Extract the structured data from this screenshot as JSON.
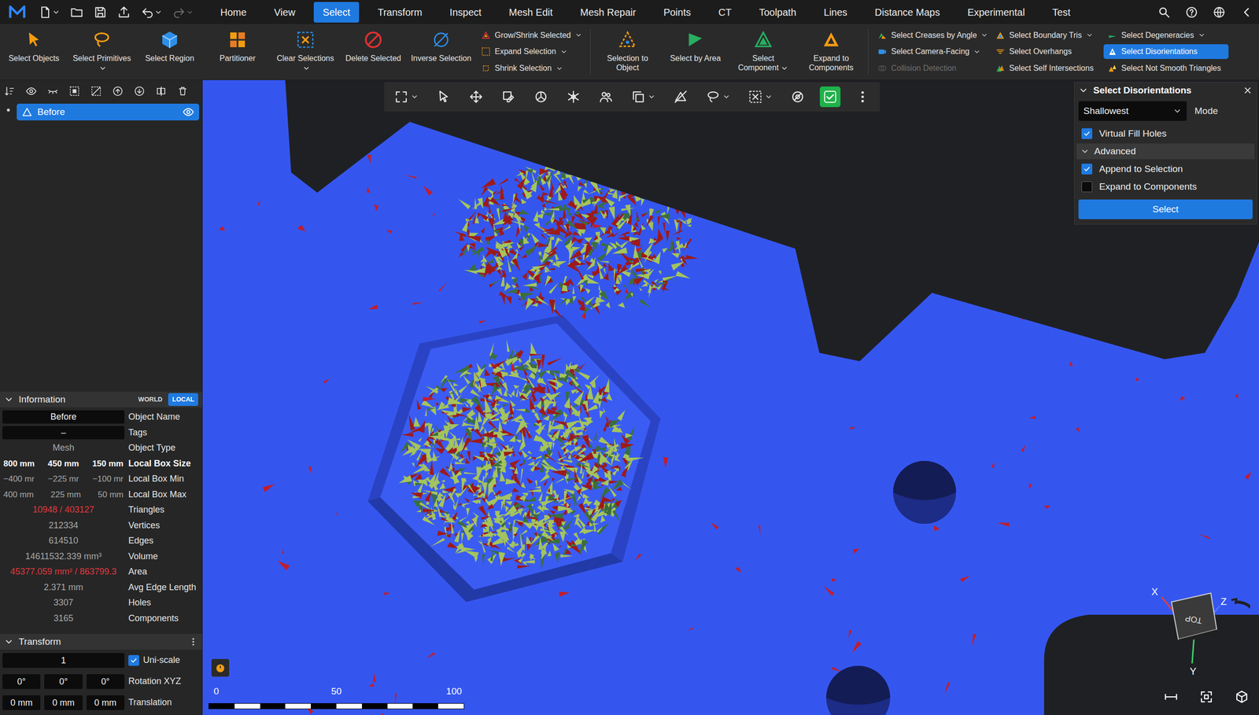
{
  "menubar": {
    "quick_tools": [
      {
        "dropdown": true,
        "disabled": false
      },
      {
        "dropdown": false,
        "disabled": false
      },
      {
        "dropdown": false,
        "disabled": false
      },
      {
        "dropdown": false,
        "disabled": false
      },
      {
        "dropdown": true,
        "disabled": false
      },
      {
        "dropdown": true,
        "disabled": true
      }
    ],
    "tabs": [
      {
        "label": "Home",
        "selected": false
      },
      {
        "label": "View",
        "selected": false
      },
      {
        "label": "Select",
        "selected": true
      },
      {
        "label": "Transform",
        "selected": false
      },
      {
        "label": "Inspect",
        "selected": false
      },
      {
        "label": "Mesh Edit",
        "selected": false
      },
      {
        "label": "Mesh Repair",
        "selected": false
      },
      {
        "label": "Points",
        "selected": false
      },
      {
        "label": "CT",
        "selected": false
      },
      {
        "label": "Toolpath",
        "selected": false
      },
      {
        "label": "Lines",
        "selected": false
      },
      {
        "label": "Distance Maps",
        "selected": false
      },
      {
        "label": "Experimental",
        "selected": false
      },
      {
        "label": "Test",
        "selected": false
      }
    ]
  },
  "ribbon": {
    "groups": [
      {
        "kind": "large",
        "items": [
          {
            "label": "Select Objects",
            "dropdown": false,
            "selected": false,
            "disabled": false
          },
          {
            "label": "Select Primitives",
            "dropdown": true,
            "selected": false,
            "disabled": false
          },
          {
            "label": "Select Region",
            "dropdown": false,
            "selected": false,
            "disabled": false
          },
          {
            "label": "Partitioner",
            "dropdown": false,
            "selected": false,
            "disabled": false
          },
          {
            "label": "Clear Selections",
            "dropdown": true,
            "selected": false,
            "disabled": false
          },
          {
            "label": "Delete Selected",
            "dropdown": false,
            "selected": false,
            "disabled": false
          },
          {
            "label": "Inverse Selection",
            "dropdown": false,
            "selected": false,
            "disabled": false
          }
        ]
      },
      {
        "kind": "small",
        "items": [
          {
            "label": "Grow/Shrink Selected",
            "dropdown": true,
            "selected": false,
            "disabled": false
          },
          {
            "label": "Expand Selection",
            "dropdown": true,
            "selected": false,
            "disabled": false
          },
          {
            "label": "Shrink Selection",
            "dropdown": true,
            "selected": false,
            "disabled": false
          }
        ]
      },
      {
        "kind": "large",
        "items": [
          {
            "label": "Selection to Object",
            "dropdown": false,
            "selected": false,
            "disabled": false
          },
          {
            "label": "Select by Area",
            "dropdown": false,
            "selected": false,
            "disabled": false
          },
          {
            "label": "Select Component",
            "dropdown": true,
            "selected": false,
            "disabled": false
          },
          {
            "label": "Expand to Components",
            "dropdown": false,
            "selected": false,
            "disabled": false
          }
        ]
      },
      {
        "kind": "small",
        "items": [
          {
            "label": "Select Creases by Angle",
            "dropdown": true,
            "selected": false,
            "disabled": false
          },
          {
            "label": "Select Camera-Facing",
            "dropdown": true,
            "selected": false,
            "disabled": false
          },
          {
            "label": "Collision Detection",
            "dropdown": false,
            "selected": false,
            "disabled": true
          }
        ]
      },
      {
        "kind": "small",
        "items": [
          {
            "label": "Select Boundary Tris",
            "dropdown": true,
            "selected": false,
            "disabled": false
          },
          {
            "label": "Select Overhangs",
            "dropdown": false,
            "selected": false,
            "disabled": false
          },
          {
            "label": "Select Self Intersections",
            "dropdown": false,
            "selected": false,
            "disabled": false
          }
        ]
      },
      {
        "kind": "small",
        "items": [
          {
            "label": "Select Degeneracies",
            "dropdown": true,
            "selected": false,
            "disabled": false
          },
          {
            "label": "Select Disorientations",
            "dropdown": false,
            "selected": true,
            "disabled": false
          },
          {
            "label": "Select Not Smooth Triangles",
            "dropdown": false,
            "selected": false,
            "disabled": false
          }
        ]
      }
    ]
  },
  "left_panel": {
    "tree": [
      {
        "label": "Before",
        "selected": true,
        "visible": true
      }
    ],
    "information": {
      "title": "Information",
      "expanded": true,
      "frames": [
        {
          "label": "WORLD",
          "selected": false
        },
        {
          "label": "LOCAL",
          "selected": true
        }
      ],
      "rows": [
        {
          "label": "Object Name",
          "kind": "field",
          "values": [
            "Before"
          ],
          "alert": false,
          "emphasis": false
        },
        {
          "label": "Tags",
          "kind": "field",
          "values": [
            "–"
          ],
          "alert": false,
          "emphasis": false
        },
        {
          "label": "Object Type",
          "kind": "text",
          "values": [
            "Mesh"
          ],
          "alert": false,
          "emphasis": false
        },
        {
          "label": "Local Box Size",
          "kind": "triple",
          "values": [
            "800 mm",
            "450 mm",
            "150 mm"
          ],
          "alert": false,
          "emphasis": true
        },
        {
          "label": "Local Box Min",
          "kind": "triple",
          "values": [
            "−400 mr",
            "−225 mr",
            "−100 mr"
          ],
          "alert": false,
          "emphasis": false
        },
        {
          "label": "Local Box Max",
          "kind": "triple",
          "values": [
            "400 mm",
            "225 mm",
            "50 mm"
          ],
          "alert": false,
          "emphasis": false
        },
        {
          "label": "Triangles",
          "kind": "text",
          "values": [
            "10948 / 403127"
          ],
          "alert": true,
          "emphasis": false
        },
        {
          "label": "Vertices",
          "kind": "text",
          "values": [
            "212334"
          ],
          "alert": false,
          "emphasis": false
        },
        {
          "label": "Edges",
          "kind": "text",
          "values": [
            "614510"
          ],
          "alert": false,
          "emphasis": false
        },
        {
          "label": "Volume",
          "kind": "text",
          "values": [
            "14611532.339 mm³"
          ],
          "alert": false,
          "emphasis": false
        },
        {
          "label": "Area",
          "kind": "text",
          "values": [
            "45377.059 mm² / 863799.3"
          ],
          "alert": true,
          "emphasis": false
        },
        {
          "label": "Avg Edge Length",
          "kind": "text",
          "values": [
            "2.371 mm"
          ],
          "alert": false,
          "emphasis": false
        },
        {
          "label": "Holes",
          "kind": "text",
          "values": [
            "3307"
          ],
          "alert": false,
          "emphasis": false
        },
        {
          "label": "Components",
          "kind": "text",
          "values": [
            "3165"
          ],
          "alert": false,
          "emphasis": false
        }
      ]
    },
    "transform": {
      "title": "Transform",
      "expanded": true,
      "rows": [
        {
          "label": "Uni-scale",
          "kind": "scale",
          "values": [
            "1"
          ],
          "checked": true
        },
        {
          "label": "Rotation XYZ",
          "kind": "triple",
          "values": [
            "0°",
            "0°",
            "0°"
          ],
          "checked": false
        },
        {
          "label": "Translation",
          "kind": "triple",
          "values": [
            "0 mm",
            "0 mm",
            "0 mm"
          ],
          "checked": false
        }
      ]
    }
  },
  "viewport": {
    "toolbar": [
      {
        "dropdown": true,
        "active": false
      },
      {
        "dropdown": false,
        "active": false
      },
      {
        "dropdown": false,
        "active": false
      },
      {
        "dropdown": false,
        "active": false
      },
      {
        "dropdown": false,
        "active": false
      },
      {
        "dropdown": false,
        "active": false
      },
      {
        "dropdown": false,
        "active": false
      },
      {
        "dropdown": true,
        "active": false
      },
      {
        "dropdown": false,
        "active": false
      },
      {
        "dropdown": true,
        "active": false
      },
      {
        "dropdown": true,
        "active": false
      },
      {
        "dropdown": false,
        "active": false
      },
      {
        "dropdown": false,
        "active": true
      },
      {
        "dropdown": false,
        "active": false
      }
    ],
    "scale_bar": {
      "ticks": [
        "0",
        "50",
        "100"
      ]
    },
    "gizmo": {
      "x": "X",
      "y": "Y",
      "z": "Z",
      "face": "TOP"
    }
  },
  "dialog": {
    "title": "Select Disorientations",
    "expanded": true,
    "mode": {
      "value": "Shallowest",
      "label": "Mode"
    },
    "options": [
      {
        "label": "Virtual Fill Holes",
        "checked": true
      }
    ],
    "advanced": {
      "title": "Advanced",
      "expanded": true,
      "options": [
        {
          "label": "Append to Selection",
          "checked": true
        },
        {
          "label": "Expand to Components",
          "checked": false
        }
      ]
    },
    "button": "Select"
  }
}
